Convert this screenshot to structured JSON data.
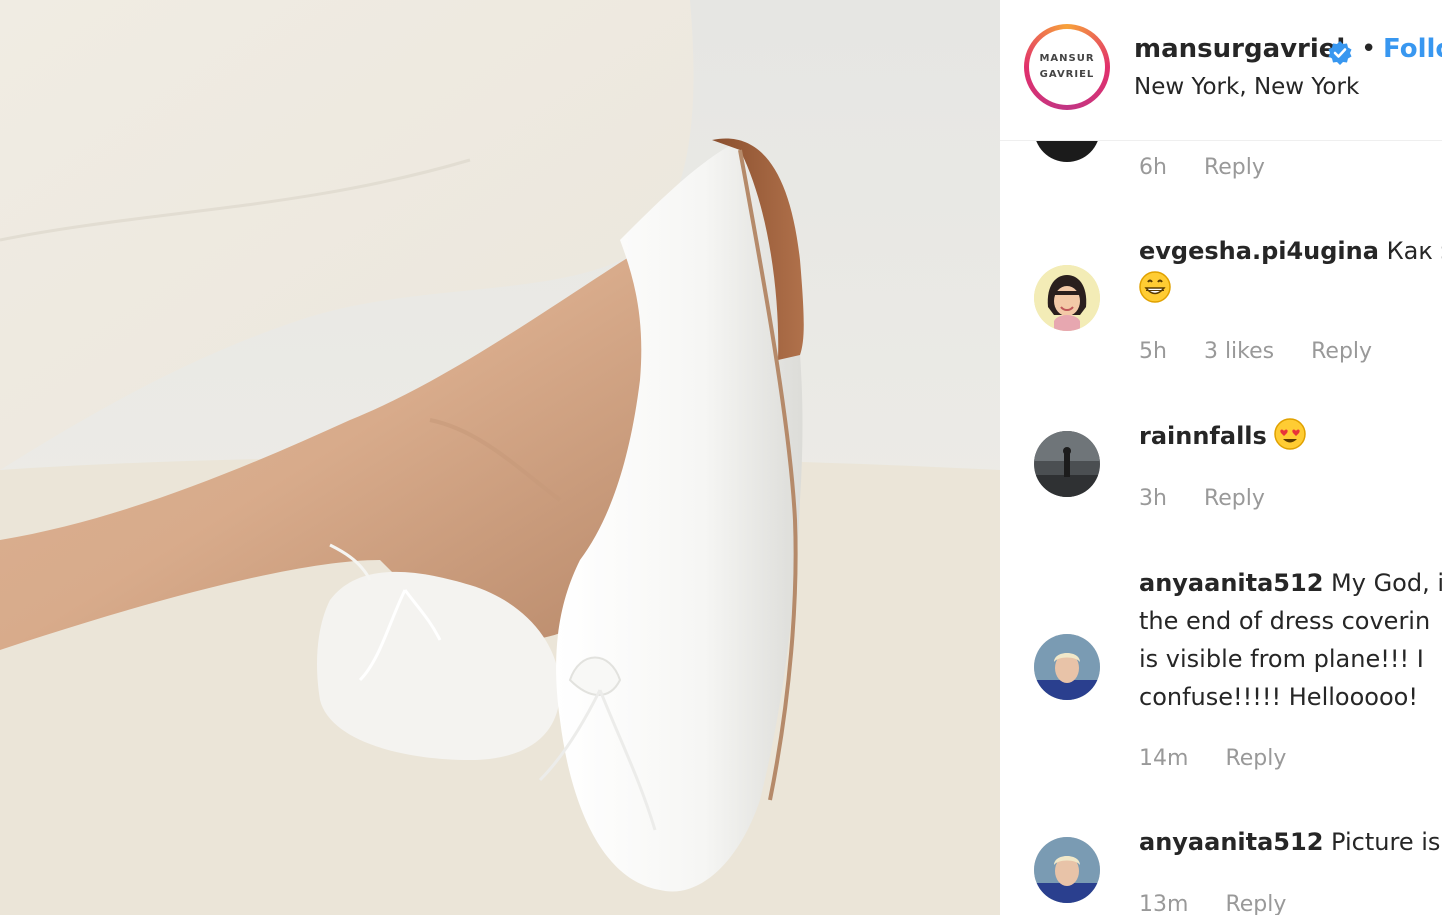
{
  "post": {
    "username": "mansurgavriel",
    "dot": "•",
    "follow_label": "Follo",
    "location": "New York, New York",
    "avatar_line1": "MANSUR",
    "avatar_line2": "GAVRIEL"
  },
  "comments": [
    {
      "time": "6h",
      "reply": "Reply"
    },
    {
      "username": "evgesha.pi4ugina",
      "text": "Как э",
      "time": "5h",
      "likes": "3 likes",
      "reply": "Reply"
    },
    {
      "username": "rainnfalls",
      "time": "3h",
      "reply": "Reply"
    },
    {
      "username": "anyaanita512",
      "lines": [
        "My God, i",
        "the end of dress coverin",
        "is visible from plane!!! I",
        "confuse!!!!! Hellooooo!"
      ],
      "time": "14m",
      "reply": "Reply"
    },
    {
      "username": "anyaanita512",
      "text": "Picture is",
      "time": "13m",
      "reply": "Reply"
    }
  ],
  "colors": {
    "link_blue": "#3897f0",
    "meta_gray": "#999999"
  },
  "icons": [
    "verified-badge-icon",
    "grinning-emoji-icon",
    "heart-eyes-emoji-icon"
  ]
}
